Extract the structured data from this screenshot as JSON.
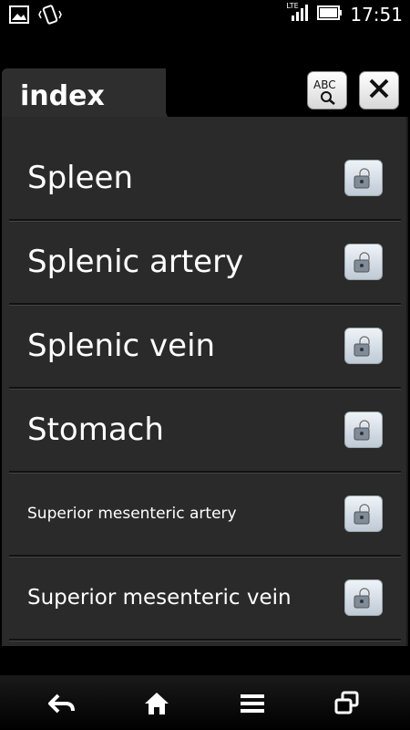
{
  "status": {
    "time": "17:51",
    "network": "LTE"
  },
  "header": {
    "tab_title": "index",
    "search_button_text": "ABC"
  },
  "items": [
    {
      "label": "Spleen",
      "size": 34
    },
    {
      "label": "Splenic artery",
      "size": 34
    },
    {
      "label": "Splenic vein",
      "size": 34
    },
    {
      "label": "Stomach",
      "size": 34
    },
    {
      "label": "Superior mesenteric artery",
      "size": 17
    },
    {
      "label": "Superior mesenteric vein",
      "size": 23
    }
  ],
  "colors": {
    "panel": "#2a2a2a",
    "background": "#000000",
    "text": "#ffffff"
  },
  "icons": [
    "gallery-icon",
    "vibrate-icon",
    "signal-icon",
    "battery-icon",
    "search-dictionary-icon",
    "close-icon",
    "lock-icon",
    "back-icon",
    "home-icon",
    "menu-icon",
    "recent-apps-icon"
  ]
}
